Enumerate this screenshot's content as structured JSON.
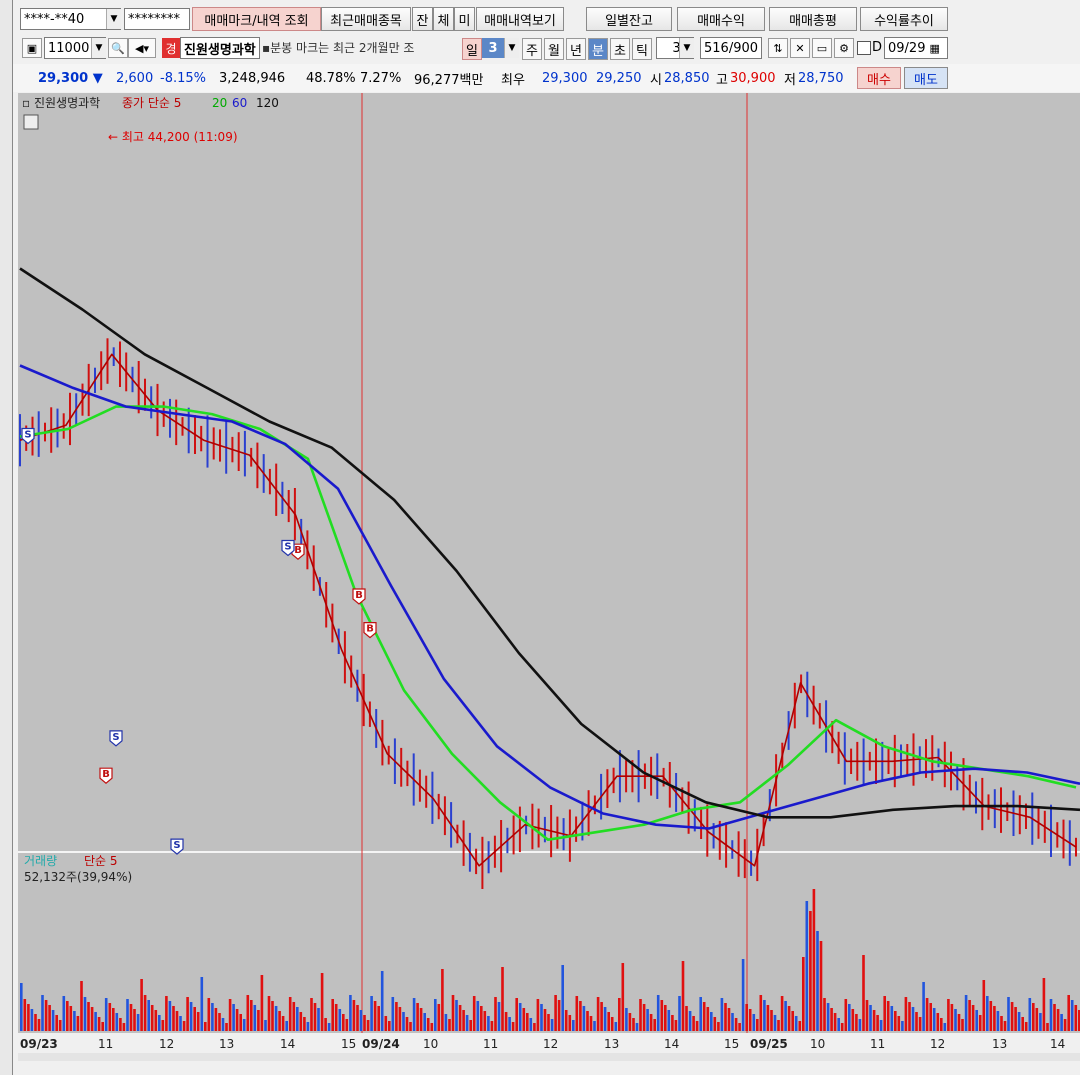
{
  "toolbar1": {
    "account": "****-**40",
    "password": "********",
    "btn_marks": "매매마크/내역 조회",
    "btn_recent": "최근매매종목",
    "btn_jan": "잔",
    "btn_che": "체",
    "btn_mi": "미",
    "btn_history": "매매내역보기",
    "btn_daily": "일별잔고",
    "btn_profit": "매매수익",
    "btn_eval": "매매총평",
    "btn_rate": "수익률추이"
  },
  "toolbar2": {
    "code": "11000",
    "badge": "경",
    "stock_name": "진원생명과학",
    "notice": "분봉 마크는 최근 2개월만 조",
    "period_label_day": "일",
    "period_value": "3",
    "tab_week": "주",
    "tab_month": "월",
    "tab_year": "년",
    "tab_min": "분",
    "tab_sec": "초",
    "tab_tick": "틱",
    "interval": "3",
    "count": "516/900",
    "d_label": "D",
    "date": "09/29"
  },
  "quote": {
    "price": "29,300",
    "change_arrow": "▼",
    "change": "2,600",
    "change_pct": "-8.15%",
    "volume": "3,248,946",
    "vol_pct": "48.78%",
    "turnover": "7.27%",
    "amount": "96,277백만",
    "best_label": "최우",
    "ask": "29,300",
    "bid": "29,250",
    "open_label": "시",
    "open": "28,850",
    "high_label": "고",
    "high": "30,900",
    "low_label": "저",
    "low": "28,750",
    "buy": "매수",
    "sell": "매도"
  },
  "colors": {
    "price_line": "#b00000",
    "ma5": "#c00000",
    "ma20": "#22dd22",
    "ma60": "#1a1acc",
    "ma120": "#111111",
    "vol_up": "#e01010",
    "vol_down": "#2255dd",
    "panel_bg": "#c0c0c0",
    "separator": "#e03030"
  },
  "chart_data": [
    {
      "type": "line",
      "title": "진원생명과학",
      "legend": [
        "종가",
        "단순",
        "5",
        "20",
        "60",
        "120"
      ],
      "annotation": "최고 44,200 (11:09)",
      "x": [
        "09/23",
        "11",
        "12",
        "13",
        "14",
        "15",
        "09/24",
        "10",
        "11",
        "12",
        "13",
        "14",
        "15",
        "09/25",
        "10",
        "11",
        "12",
        "13",
        "14"
      ],
      "ylim": [
        27000,
        46500
      ],
      "series": [
        {
          "name": "종가",
          "values": [
            40200,
            40600,
            42500,
            41000,
            40200,
            39800,
            38200,
            34600,
            31800,
            30600,
            28800,
            29900,
            29600,
            31200,
            31200,
            29700,
            28800,
            33700,
            31600,
            31600,
            31700,
            30400,
            30100,
            29300
          ]
        },
        {
          "name": "20",
          "values": [
            40300,
            40500,
            41100,
            41100,
            40900,
            40500,
            39700,
            36100,
            33500,
            31800,
            30500,
            29500,
            29700,
            29900,
            30300,
            30500,
            31500,
            32700,
            32000,
            31600,
            31400,
            31200,
            30900
          ]
        },
        {
          "name": "60",
          "values": [
            42200,
            41600,
            41100,
            40900,
            40700,
            40100,
            38900,
            36300,
            33800,
            32000,
            30900,
            30200,
            29900,
            29800,
            30200,
            30600,
            31000,
            31300,
            31400,
            31300,
            31000
          ]
        },
        {
          "name": "120",
          "values": [
            44800,
            43700,
            42500,
            41600,
            40700,
            40000,
            38600,
            36700,
            34500,
            32600,
            31300,
            30500,
            30100,
            30100,
            30300,
            30400,
            30400,
            30300
          ]
        }
      ],
      "markers": [
        {
          "label": "S",
          "x": "09/23",
          "y": 40300
        },
        {
          "label": "B",
          "x": "14",
          "y": 37200
        },
        {
          "label": "S",
          "x": "14",
          "y": 37300
        },
        {
          "label": "B",
          "x": "15",
          "y": 36000
        },
        {
          "label": "B",
          "x": "09/24",
          "y": 35100
        },
        {
          "label": "S",
          "x": "11",
          "y": 32200
        },
        {
          "label": "B",
          "x": "11",
          "y": 31200
        },
        {
          "label": "S",
          "x": "12",
          "y": 29300
        }
      ]
    },
    {
      "type": "bar",
      "title": "거래량",
      "legend": [
        "거래량",
        "단순",
        "5"
      ],
      "annotation": "52,132주(39,94%)",
      "x": [
        "09/23",
        "11",
        "12",
        "13",
        "14",
        "15",
        "09/24",
        "10",
        "11",
        "12",
        "13",
        "14",
        "15",
        "09/25",
        "10",
        "11",
        "12",
        "13",
        "14"
      ],
      "peak_value": 52132
    }
  ]
}
